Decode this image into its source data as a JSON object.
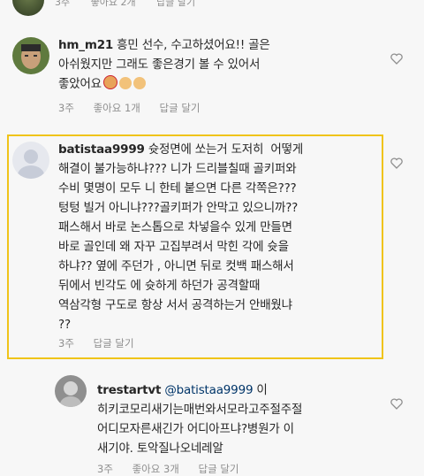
{
  "top": {
    "time": "3주",
    "likes": "좋아요 2개",
    "reply": "답글 달기"
  },
  "comments": [
    {
      "username": "hm_m21",
      "text": " 흥민 선수, 수고하셨어요!! 골은\n아쉬웠지만 그래도 좋은경기 볼 수 있어서\n좋았어요",
      "time": "3주",
      "likes": "좋아요 1개",
      "reply": "답글 달기"
    },
    {
      "username": "batistaa9999",
      "text": " 슛정면에 쏘는거 도저히  어떻게\n해결이 불가능하냐??? 니가 드리블칠때 골키퍼와\n수비 몇명이 모두 니 한테 붙으면 다른 각쪽은???\n텅텅 빌거 아니냐???골키퍼가 안막고 있으니까??\n패스해서 바로 논스톱으로 차넣을수 있게 만들면\n바로 골인데 왜 자꾸 고집부려서 막힌 각에 슛을\n하냐?? 옆에 주던가 , 아니면 뒤로 컷백 패스해서\n뒤에서 빈각도 에 슛하게 하던가 공격할때\n역삼각형 구도로 항상 서서 공격하는거 안배웠냐\n??",
      "time": "3주",
      "reply": "답글 달기"
    },
    {
      "username": "trestartvt",
      "mention": "@batistaa9999",
      "text": " 이\n히키코모리새기는매번와서모라고주절주절\n어디모자른새긴가 어디아프냐?병원가 이\n새기야. 토악질나오네레알",
      "time": "3주",
      "likes": "좋아요 3개",
      "reply": "답글 달기"
    }
  ],
  "colors": {
    "highlight": "#f0c419",
    "meta": "#8e8e8e",
    "mention": "#003569"
  },
  "icons": [
    "heart-icon",
    "avatar-default-icon",
    "thumbs-up-emoji",
    "face-emoji"
  ]
}
